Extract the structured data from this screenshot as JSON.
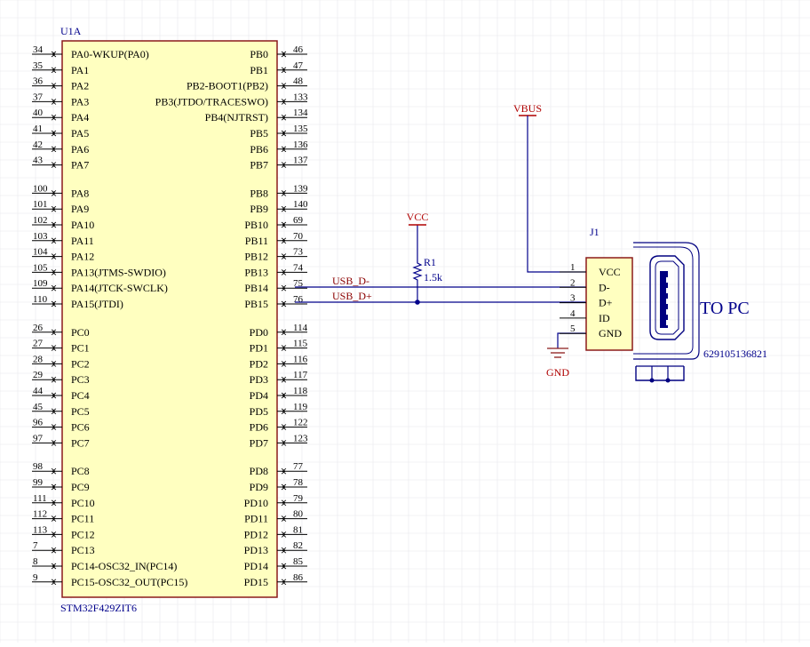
{
  "colors": {
    "component_line": "#8b1a1a",
    "component_fill": "#ffffc0",
    "wire": "#00008b",
    "power_text": "#b00000",
    "label_text": "#00008b",
    "pin_text": "#000000",
    "grid": "#e8e8ec",
    "connector": "#000080",
    "net_label": "#8b0000"
  },
  "u1": {
    "designator": "U1A",
    "part": "STM32F429ZIT6",
    "left_pins": [
      {
        "num": "34",
        "name": "PA0-WKUP(PA0)"
      },
      {
        "num": "35",
        "name": "PA1"
      },
      {
        "num": "36",
        "name": "PA2"
      },
      {
        "num": "37",
        "name": "PA3"
      },
      {
        "num": "40",
        "name": "PA4"
      },
      {
        "num": "41",
        "name": "PA5"
      },
      {
        "num": "42",
        "name": "PA6"
      },
      {
        "num": "43",
        "name": "PA7"
      },
      {
        "num": "100",
        "name": "PA8"
      },
      {
        "num": "101",
        "name": "PA9"
      },
      {
        "num": "102",
        "name": "PA10"
      },
      {
        "num": "103",
        "name": "PA11"
      },
      {
        "num": "104",
        "name": "PA12"
      },
      {
        "num": "105",
        "name": "PA13(JTMS-SWDIO)"
      },
      {
        "num": "109",
        "name": "PA14(JTCK-SWCLK)"
      },
      {
        "num": "110",
        "name": "PA15(JTDI)"
      },
      {
        "num": "26",
        "name": "PC0"
      },
      {
        "num": "27",
        "name": "PC1"
      },
      {
        "num": "28",
        "name": "PC2"
      },
      {
        "num": "29",
        "name": "PC3"
      },
      {
        "num": "44",
        "name": "PC4"
      },
      {
        "num": "45",
        "name": "PC5"
      },
      {
        "num": "96",
        "name": "PC6"
      },
      {
        "num": "97",
        "name": "PC7"
      },
      {
        "num": "98",
        "name": "PC8"
      },
      {
        "num": "99",
        "name": "PC9"
      },
      {
        "num": "111",
        "name": "PC10"
      },
      {
        "num": "112",
        "name": "PC11"
      },
      {
        "num": "113",
        "name": "PC12"
      },
      {
        "num": "7",
        "name": "PC13"
      },
      {
        "num": "8",
        "name": "PC14-OSC32_IN(PC14)"
      },
      {
        "num": "9",
        "name": "PC15-OSC32_OUT(PC15)"
      }
    ],
    "right_pins": [
      {
        "num": "46",
        "name": "PB0"
      },
      {
        "num": "47",
        "name": "PB1"
      },
      {
        "num": "48",
        "name": "PB2-BOOT1(PB2)"
      },
      {
        "num": "133",
        "name": "PB3(JTDO/TRACESWO)"
      },
      {
        "num": "134",
        "name": "PB4(NJTRST)"
      },
      {
        "num": "135",
        "name": "PB5"
      },
      {
        "num": "136",
        "name": "PB6"
      },
      {
        "num": "137",
        "name": "PB7"
      },
      {
        "num": "139",
        "name": "PB8"
      },
      {
        "num": "140",
        "name": "PB9"
      },
      {
        "num": "69",
        "name": "PB10"
      },
      {
        "num": "70",
        "name": "PB11"
      },
      {
        "num": "73",
        "name": "PB12"
      },
      {
        "num": "74",
        "name": "PB13"
      },
      {
        "num": "75",
        "name": "PB14"
      },
      {
        "num": "76",
        "name": "PB15"
      },
      {
        "num": "114",
        "name": "PD0"
      },
      {
        "num": "115",
        "name": "PD1"
      },
      {
        "num": "116",
        "name": "PD2"
      },
      {
        "num": "117",
        "name": "PD3"
      },
      {
        "num": "118",
        "name": "PD4"
      },
      {
        "num": "119",
        "name": "PD5"
      },
      {
        "num": "122",
        "name": "PD6"
      },
      {
        "num": "123",
        "name": "PD7"
      },
      {
        "num": "77",
        "name": "PD8"
      },
      {
        "num": "78",
        "name": "PD9"
      },
      {
        "num": "79",
        "name": "PD10"
      },
      {
        "num": "80",
        "name": "PD11"
      },
      {
        "num": "81",
        "name": "PD12"
      },
      {
        "num": "82",
        "name": "PD13"
      },
      {
        "num": "85",
        "name": "PD14"
      },
      {
        "num": "86",
        "name": "PD15"
      }
    ]
  },
  "r1": {
    "designator": "R1",
    "value": "1.5k"
  },
  "power": {
    "vcc": "VCC",
    "vbus": "VBUS",
    "gnd": "GND"
  },
  "nets": {
    "usb_dm": "USB_D-",
    "usb_dp": "USB_D+"
  },
  "j1": {
    "designator": "J1",
    "part": "629105136821",
    "pins": [
      {
        "num": "1",
        "name": "VCC"
      },
      {
        "num": "2",
        "name": "D-"
      },
      {
        "num": "3",
        "name": "D+"
      },
      {
        "num": "4",
        "name": "ID"
      },
      {
        "num": "5",
        "name": "GND"
      }
    ]
  },
  "annotation": "TO PC"
}
